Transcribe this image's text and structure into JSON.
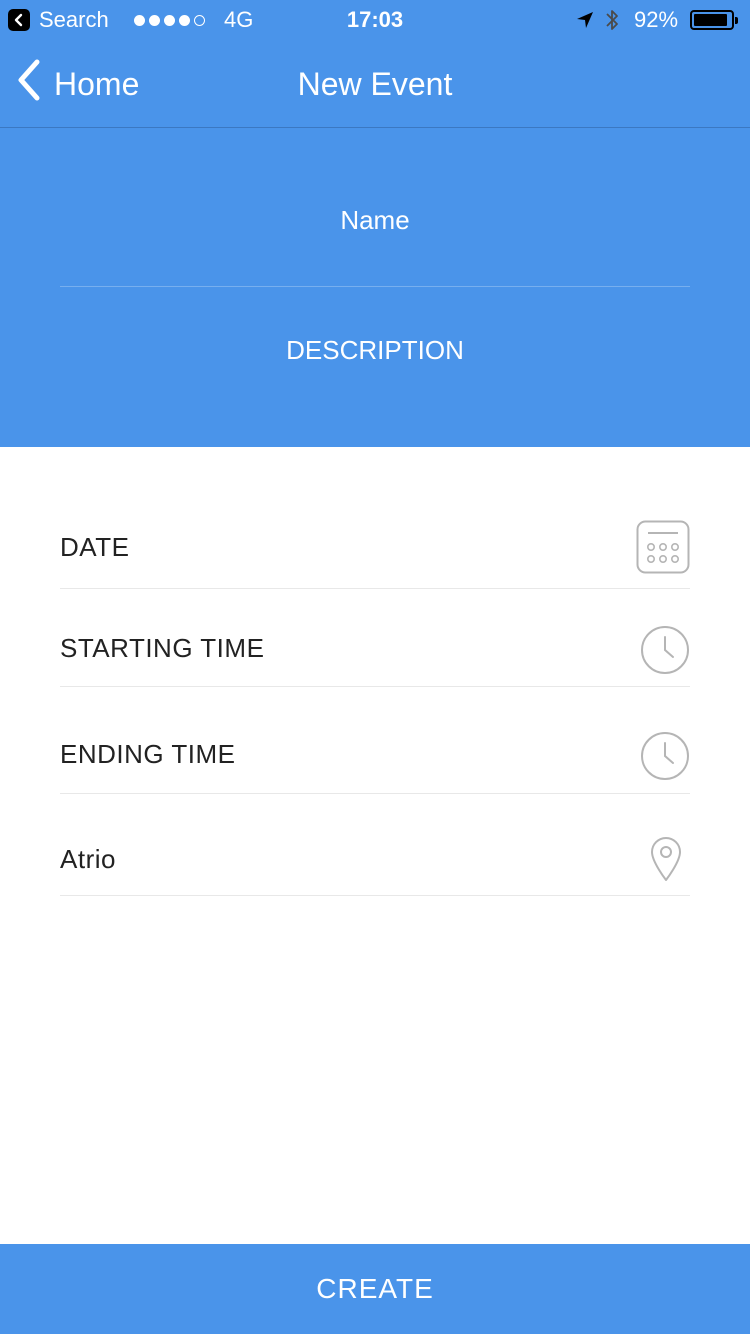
{
  "status_bar": {
    "back_app": "Search",
    "network": "4G",
    "time": "17:03",
    "battery": "92%",
    "battery_level": 0.92,
    "signal_bars": 4,
    "signal_total": 5
  },
  "nav": {
    "back_label": "Home",
    "title": "New Event"
  },
  "header_form": {
    "name_placeholder": "Name",
    "description_placeholder": "DESCRIPTION"
  },
  "fields": {
    "date_label": "DATE",
    "start_label": "STARTING TIME",
    "end_label": "ENDING TIME",
    "location_value": "Atrio"
  },
  "icons": {
    "back": "chevron-left-icon",
    "date": "calendar-icon",
    "time": "clock-icon",
    "location": "map-pin-icon"
  },
  "colors": {
    "primary": "#4a94ea",
    "text": "#222222",
    "icon_gray": "#b5b5b5",
    "divider": "#e8e8e8"
  },
  "footer": {
    "create_label": "CREATE"
  }
}
